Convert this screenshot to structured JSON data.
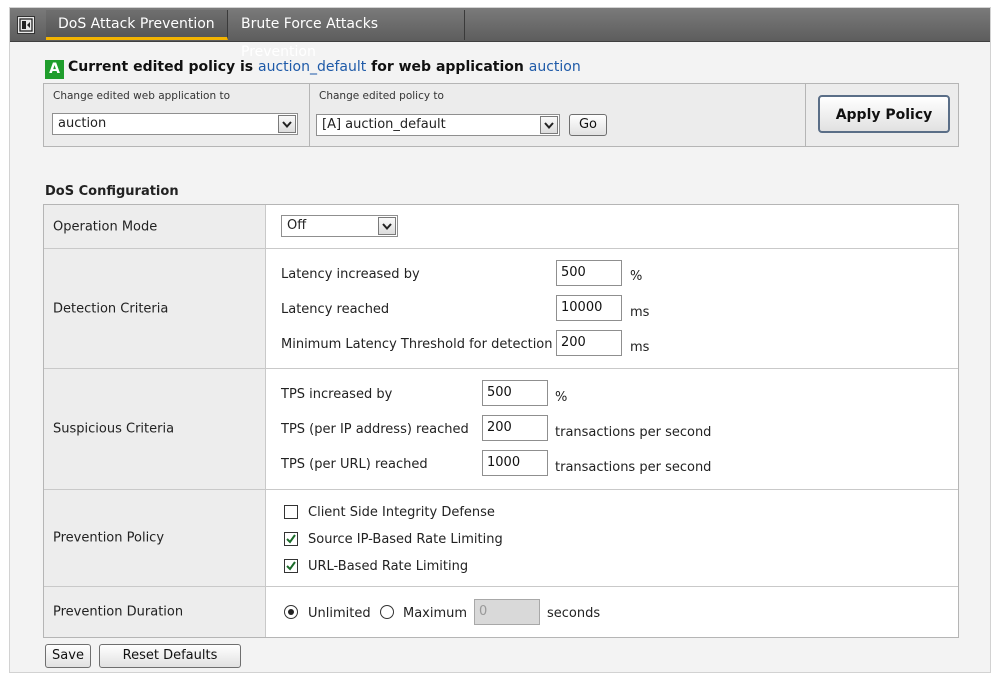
{
  "tabs": [
    {
      "label": "DoS Attack Prevention",
      "active": true
    },
    {
      "label": "Brute Force Attacks Prevention",
      "active": false
    }
  ],
  "policy_header": {
    "badge": "A",
    "prefix": "Current edited policy is",
    "policy_name": "auction_default",
    "middle": "for web application",
    "app_name": "auction"
  },
  "policy_selector": {
    "app_label": "Change edited web application to",
    "app_value": "auction",
    "policy_label": "Change edited policy to",
    "policy_value": "[A] auction_default",
    "go_label": "Go",
    "apply_label": "Apply Policy"
  },
  "dos_config": {
    "title": "DoS Configuration",
    "operation_mode": {
      "label": "Operation Mode",
      "value": "Off"
    },
    "detection_criteria": {
      "label": "Detection Criteria",
      "latency_increased": {
        "label": "Latency increased by",
        "value": "500",
        "unit": "%"
      },
      "latency_reached": {
        "label": "Latency reached",
        "value": "10000",
        "unit": "ms"
      },
      "min_latency": {
        "label": "Minimum Latency Threshold for detection",
        "value": "200",
        "unit": "ms"
      }
    },
    "suspicious_criteria": {
      "label": "Suspicious Criteria",
      "tps_increased": {
        "label": "TPS increased by",
        "value": "500",
        "unit": "%"
      },
      "tps_ip": {
        "label": "TPS (per IP address) reached",
        "value": "200",
        "unit": "transactions per second"
      },
      "tps_url": {
        "label": "TPS (per URL) reached",
        "value": "1000",
        "unit": "transactions per second"
      }
    },
    "prevention_policy": {
      "label": "Prevention Policy",
      "options": [
        {
          "label": "Client Side Integrity Defense",
          "checked": false
        },
        {
          "label": "Source IP-Based Rate Limiting",
          "checked": true
        },
        {
          "label": "URL-Based Rate Limiting",
          "checked": true
        }
      ]
    },
    "prevention_duration": {
      "label": "Prevention Duration",
      "unlimited_label": "Unlimited",
      "maximum_label": "Maximum",
      "maximum_value": "0",
      "unit": "seconds",
      "selected": "unlimited"
    }
  },
  "actions": {
    "save_label": "Save",
    "reset_label": "Reset Defaults"
  },
  "colors": {
    "tab_accent": "#f2b300",
    "link": "#1e5aa8",
    "badge": "#1f9d2c"
  }
}
